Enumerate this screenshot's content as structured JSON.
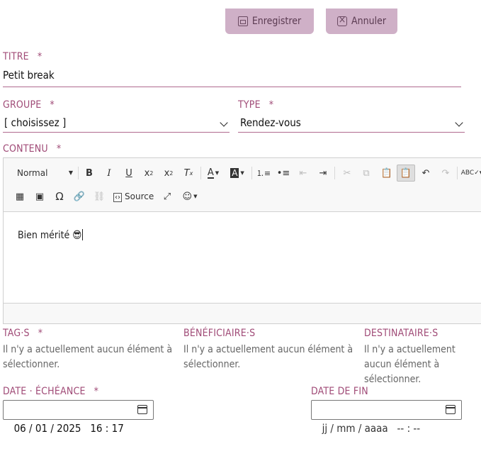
{
  "actions": {
    "save_label": "Enregistrer",
    "cancel_label": "Annuler"
  },
  "form": {
    "title": {
      "label": "TITRE",
      "required": "*",
      "value": "Petit break"
    },
    "group": {
      "label": "GROUPE",
      "required": "*",
      "value": "[ choisissez ]"
    },
    "type": {
      "label": "TYPE",
      "required": "*",
      "value": "Rendez-vous"
    },
    "content": {
      "label": "CONTENU",
      "required": "*",
      "text": "Bien mérité 😎"
    },
    "tags": {
      "label": "TAG·S",
      "required": "*",
      "help": "Il n'y a actuellement aucun élément à sélectionner."
    },
    "beneficiaries": {
      "label": "BÉNÉFICIAIRE·S",
      "help": "Il n'y a actuellement aucun élément à sélectionner."
    },
    "recipients": {
      "label": "DESTINATAIRE·S",
      "help": "Il n'y a actuellement aucun élément à sélectionner."
    },
    "due_date": {
      "label": "DATE · ÉCHÉANCE",
      "required": "*",
      "value": "06 / 01 / 2025   16 : 17"
    },
    "end_date": {
      "label": "DATE DE FIN",
      "placeholder": "jj / mm / aaaa   -- : --"
    }
  },
  "editor": {
    "format_select": "Normal",
    "source_label": "Source"
  }
}
